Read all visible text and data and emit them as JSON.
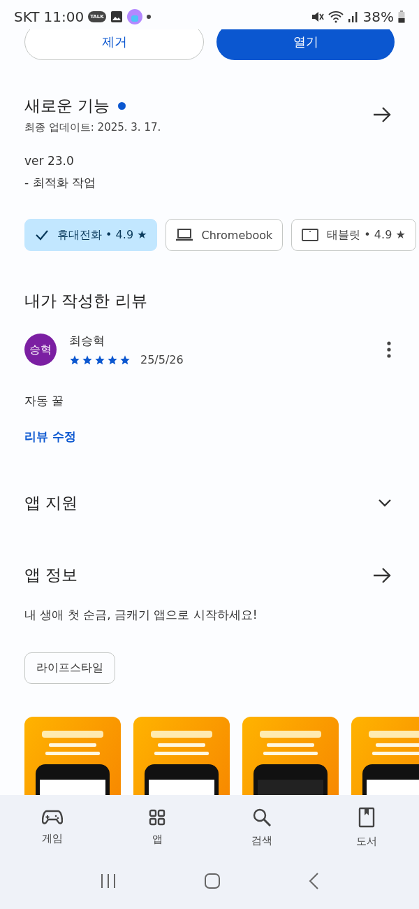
{
  "status_bar": {
    "carrier": "SKT",
    "time": "11:00",
    "notification_badge": "TALK",
    "battery": "38%"
  },
  "actions": [
    {
      "label": "제거",
      "kind": "outline"
    },
    {
      "label": "열기",
      "kind": "filled"
    }
  ],
  "whats_new": {
    "title": "새로운 기능",
    "new_dot": true,
    "updated": "최종 업데이트: 2025. 3. 17.",
    "lines": [
      "ver 23.0",
      "- 최적화 작업"
    ]
  },
  "devices": [
    {
      "label": "휴대전화 • 4.9 ★",
      "kind": "phone",
      "selected": true
    },
    {
      "label": "Chromebook",
      "kind": "laptop",
      "selected": false
    },
    {
      "label": "태블릿 • 4.9 ★",
      "kind": "tablet",
      "selected": false
    }
  ],
  "my_review": {
    "title": "내가 작성한 리뷰",
    "avatar": "승혁",
    "author": "최승혁",
    "stars": 5,
    "date": "25/5/26",
    "text": "자동 꿀",
    "edit_link": "리뷰 수정"
  },
  "app_support": {
    "title": "앱 지원",
    "expanded": false
  },
  "app_info": {
    "title": "앱 정보",
    "description": "내 생애 첫 순금, 금캐기 앱으로 시작하세요!",
    "category": "라이프스타일"
  },
  "bottom_nav": [
    {
      "label": "게임",
      "kind": "games",
      "selected": false
    },
    {
      "label": "앱",
      "kind": "apps",
      "selected": false
    },
    {
      "label": "검색",
      "kind": "search",
      "selected": false
    },
    {
      "label": "도서",
      "kind": "books",
      "selected": false
    }
  ]
}
